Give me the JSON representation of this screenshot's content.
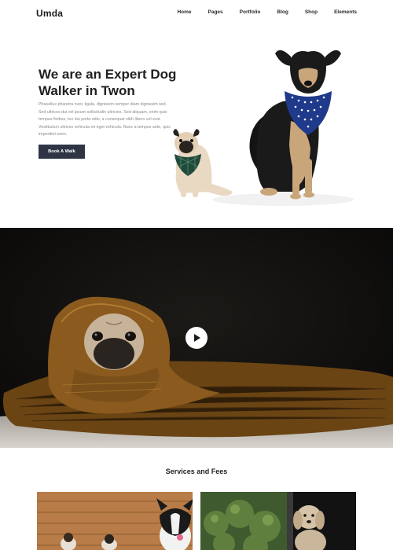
{
  "header": {
    "logo": "Umda",
    "nav": [
      {
        "label": "Home"
      },
      {
        "label": "Pages"
      },
      {
        "label": "Portfolio"
      },
      {
        "label": "Blog"
      },
      {
        "label": "Shop"
      },
      {
        "label": "Elements"
      }
    ]
  },
  "hero": {
    "title": "We are an Expert Dog Walker in Twon",
    "body": "Phasellus pharetra nunc ligula, dignissim semper diam dignissim sed. Sed ultrices dui vel ipsum sollicitudin ultricies. Sed aliquam, enim quis tempus finibus, leo dui porta odio, a consequat nibh libero vel erat. Vestibulum ultrices vehicula mi eget vehicula. Nunc a tempus ante, quis imperdiet enim.",
    "button_label": "Book A Walk"
  },
  "services": {
    "title": "Services and Fees"
  },
  "colors": {
    "button_bg": "#2f3545",
    "video_bg": "#0f0e0d",
    "blanket": "#8a5a1e",
    "bandana_blue": "#1f3a8a",
    "bandana_green": "#1f4a3a"
  }
}
